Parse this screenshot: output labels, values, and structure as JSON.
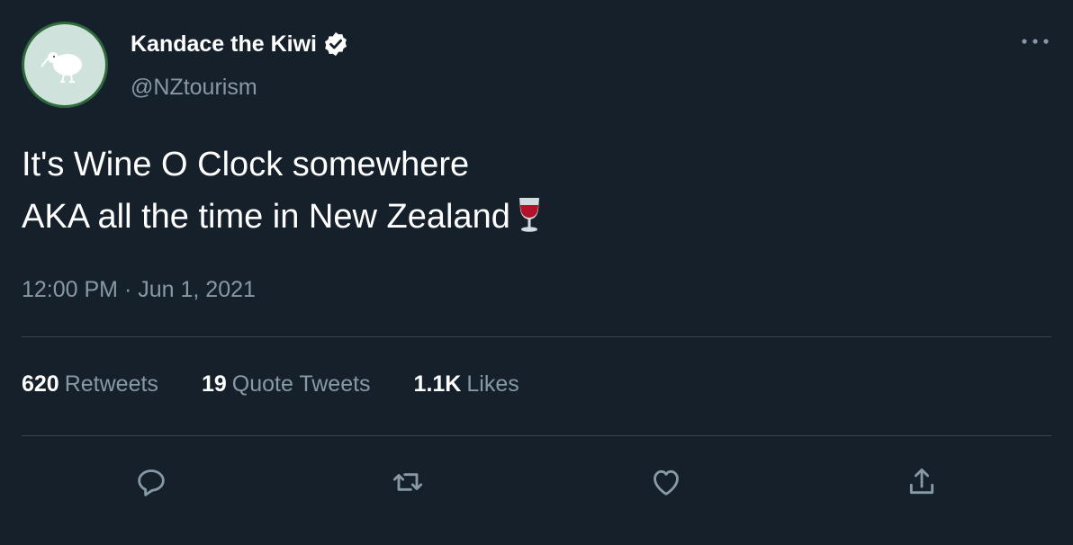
{
  "author": {
    "display_name": "Kandace the Kiwi",
    "handle": "@NZtourism",
    "verified": true,
    "avatar_icon": "kiwi-bird-icon"
  },
  "tweet": {
    "lines": [
      "It's Wine O Clock somewhere",
      "AKA all the time in New Zealand"
    ],
    "emoji": "wine-glass-icon",
    "time": "12:00 PM",
    "separator": "·",
    "date": "Jun 1, 2021"
  },
  "stats": {
    "retweets_count": "620",
    "retweets_label": "Retweets",
    "quotes_count": "19",
    "quotes_label": "Quote Tweets",
    "likes_count": "1.1K",
    "likes_label": "Likes"
  },
  "actions": [
    "reply-icon",
    "retweet-icon",
    "like-icon",
    "share-icon"
  ],
  "colors": {
    "background": "#15202b",
    "secondary_text": "#8899a6",
    "divider": "#38444d",
    "verified_badge": "#ffffff"
  }
}
